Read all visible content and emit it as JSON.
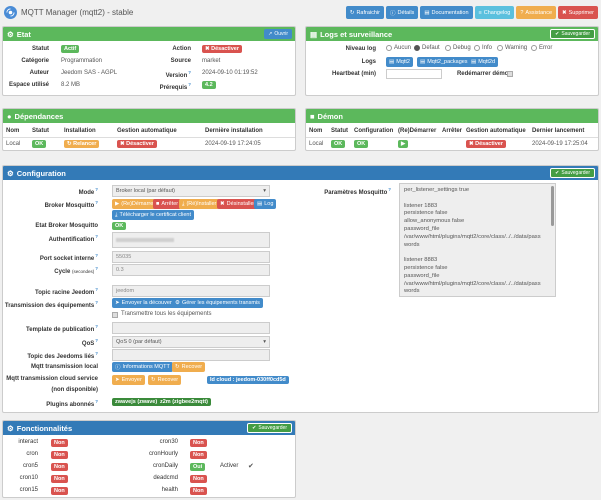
{
  "header": {
    "title": "MQTT Manager (mqtt2) - stable",
    "buttons": [
      {
        "label": "Rafraichir",
        "color": "#428bca",
        "icon": "refresh-icon"
      },
      {
        "label": "Détails",
        "color": "#428bca",
        "icon": "info-icon"
      },
      {
        "label": "Documentation",
        "color": "#428bca",
        "icon": "book-icon"
      },
      {
        "label": "Changelog",
        "color": "#5bc0de",
        "icon": "list-icon"
      },
      {
        "label": "Assistance",
        "color": "#f0ad4e",
        "icon": "help-icon"
      },
      {
        "label": "Supprimer",
        "color": "#d9534f",
        "icon": "trash-icon"
      }
    ]
  },
  "etat": {
    "title": "Etat",
    "open_btn": "Ouvrir",
    "statut_label": "Statut",
    "statut_value": "Actif",
    "categorie_label": "Catégorie",
    "categorie_value": "Programmation",
    "auteur_label": "Auteur",
    "auteur_value": "Jeedom SAS - AGPL",
    "espace_label": "Espace utilisé",
    "espace_value": "8.2 MB",
    "action_label": "Action",
    "action_value": "Désactiver",
    "source_label": "Source",
    "source_value": "market",
    "version_label": "Version",
    "version_value": "2024-09-10 01:19:52",
    "prerequis_label": "Prérequis",
    "prerequis_value": "4.2"
  },
  "logs": {
    "title": "Logs et surveillance",
    "save_btn": "Sauvegarder",
    "niveau_label": "Niveau log",
    "levels": [
      "Aucun",
      "Defaut",
      "Debug",
      "Info",
      "Warning",
      "Error"
    ],
    "selected_level": "Defaut",
    "logs_label": "Logs",
    "log_btns": [
      "Mqtt2",
      "Mqtt2_packages",
      "Mqtt2d"
    ],
    "heartbeat_label": "Heartbeat (min)",
    "redemarrer_label": "Redémarrer démon"
  },
  "dependances": {
    "title": "Dépendances",
    "headers": [
      "Nom",
      "Statut",
      "Installation",
      "Gestion automatique",
      "Dernière installation"
    ],
    "row": {
      "nom": "Local",
      "statut": "OK",
      "installation": "Relancer",
      "gestion": "Désactiver",
      "derniere": "2024-09-19 17:24:05"
    }
  },
  "demon": {
    "title": "Démon",
    "headers": [
      "Nom",
      "Statut",
      "Configuration",
      "(Re)Démarrer",
      "Arrêter",
      "Gestion automatique",
      "Dernier lancement"
    ],
    "row": {
      "nom": "Local",
      "statut": "OK",
      "configuration": "OK",
      "gestion": "Désactiver",
      "dernier": "2024-09-19 17:25:04"
    }
  },
  "configuration": {
    "title": "Configuration",
    "save_btn": "Sauvegarder",
    "mode_label": "Mode",
    "mode_value": "Broker local (par défaut)",
    "broker_label": "Broker Mosquitto",
    "broker_btns": [
      {
        "label": "(Re)Démarrer",
        "color": "#f0ad4e",
        "icon": "play-icon"
      },
      {
        "label": "Arrêter",
        "color": "#d9534f",
        "icon": "stop-icon"
      },
      {
        "label": "(Ré)Installer",
        "color": "#f0ad4e",
        "icon": "install-icon"
      },
      {
        "label": "Désinstaller",
        "color": "#d9534f",
        "icon": "trash-icon"
      },
      {
        "label": "Log",
        "color": "#428bca",
        "icon": "file-icon"
      }
    ],
    "cert_btn": "Télécharger le certificat client",
    "etat_broker_label": "Etat Broker Mosquitto",
    "etat_broker_value": "OK",
    "auth_label": "Authentification",
    "port_label": "Port socket interne",
    "port_value": "55035",
    "cycle_label": "Cycle",
    "cycle_sub": "(secondes)",
    "cycle_value": "0.3",
    "topic_label": "Topic racine Jeedom",
    "topic_value": "jeedom",
    "transmission_label": "Transmission des équipements",
    "trans_btn1": "Envoyer la découverte",
    "trans_btn2": "Gérer les équipements transmis",
    "trans_all": "Transmettre tous les équipements",
    "template_label": "Template de publication",
    "qos_label": "QoS",
    "qos_value": "QoS 0 (par défaut)",
    "topics_lies_label": "Topic des Jeedoms liés",
    "mqtt_trans_label": "Mqtt transmission local",
    "info_btn": "Informations MQTT",
    "recover_btn": "Recover",
    "cloud_label": "Mqtt transmission cloud service",
    "cloud_sub": "(non disponible)",
    "cloud_send": "Envoyer",
    "cloud_recover": "Recover",
    "cloud_id": "Id cloud : jeedom-030ff0cd5d",
    "plugins_label": "Plugins abonnés",
    "plugins": [
      "zwavejs (zwave)",
      "z2m (zigbee2mqtt)"
    ],
    "params_label": "Paramètres Mosquitto",
    "params_lines": [
      "per_listener_settings true",
      "",
      "listener 1883",
      "persistence false",
      "allow_anonymous false",
      "password_file",
      "/var/www/html/plugins/mqtt2/core/class/../../data/pass",
      "words",
      "",
      "listener 8883",
      "persistence false",
      "password_file",
      "/var/www/html/plugins/mqtt2/core/class/../../data/pass",
      "words"
    ]
  },
  "fonctionnalites": {
    "title": "Fonctionnalités",
    "save_btn": "Sauvegarder",
    "left": [
      {
        "name": "interact",
        "value": "Non"
      },
      {
        "name": "cron",
        "value": "Non"
      },
      {
        "name": "cron5",
        "value": "Non"
      },
      {
        "name": "cron10",
        "value": "Non"
      },
      {
        "name": "cron15",
        "value": "Non"
      }
    ],
    "right": [
      {
        "name": "cron30",
        "value": "Non"
      },
      {
        "name": "cronHourly",
        "value": "Non"
      },
      {
        "name": "cronDaily",
        "value": "Oui"
      },
      {
        "name": "deadcmd",
        "value": "Non"
      },
      {
        "name": "health",
        "value": "Non"
      }
    ],
    "activer_label": "Activer"
  }
}
